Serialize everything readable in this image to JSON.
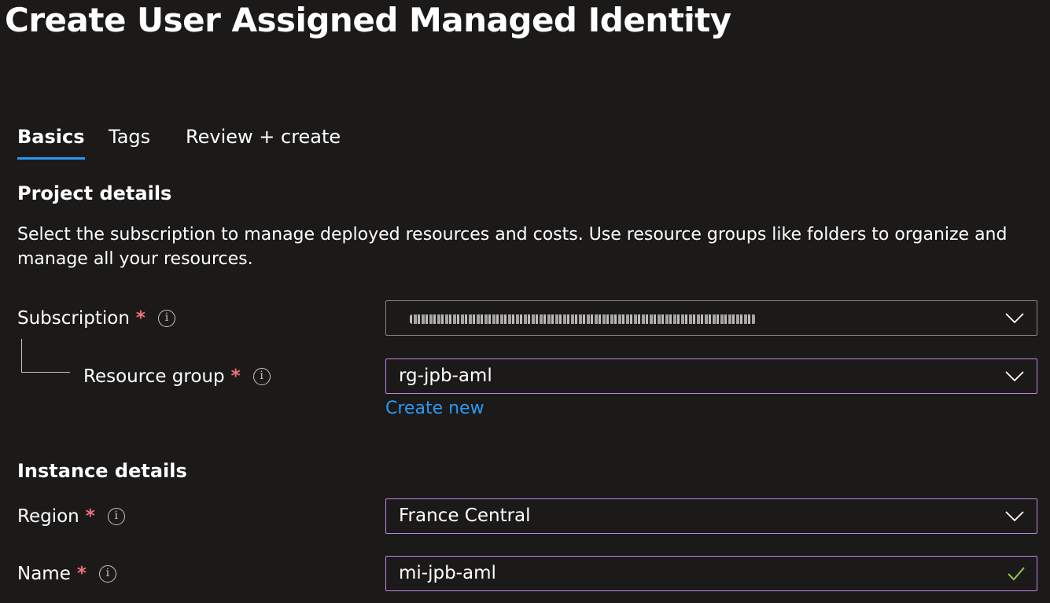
{
  "page": {
    "title": "Create User Assigned Managed Identity",
    "more_label": "···"
  },
  "tabs": [
    {
      "label": "Basics",
      "active": true
    },
    {
      "label": "Tags",
      "active": false
    },
    {
      "label": "Review + create",
      "active": false
    }
  ],
  "project": {
    "heading": "Project details",
    "description": "Select the subscription to manage deployed resources and costs. Use resource groups like folders to organize and manage all your resources."
  },
  "fields": {
    "subscription": {
      "label": "Subscription",
      "required_mark": "*",
      "value": ""
    },
    "resource_group": {
      "label": "Resource group",
      "required_mark": "*",
      "value": "rg-jpb-aml",
      "create_new_label": "Create new"
    },
    "region": {
      "label": "Region",
      "required_mark": "*",
      "value": "France Central"
    },
    "name": {
      "label": "Name",
      "required_mark": "*",
      "value": "mi-jpb-aml"
    }
  },
  "instance": {
    "heading": "Instance details"
  },
  "icons": {
    "info": "info-icon",
    "chevron": "chevron-down-icon",
    "check": "checkmark-icon",
    "more": "more-icon"
  },
  "colors": {
    "background": "#1b1a19",
    "accent_tab": "#2899f5",
    "link": "#2899f5",
    "required": "#f1707b",
    "focus_border": "#c084e8",
    "valid_check": "#92c353"
  }
}
